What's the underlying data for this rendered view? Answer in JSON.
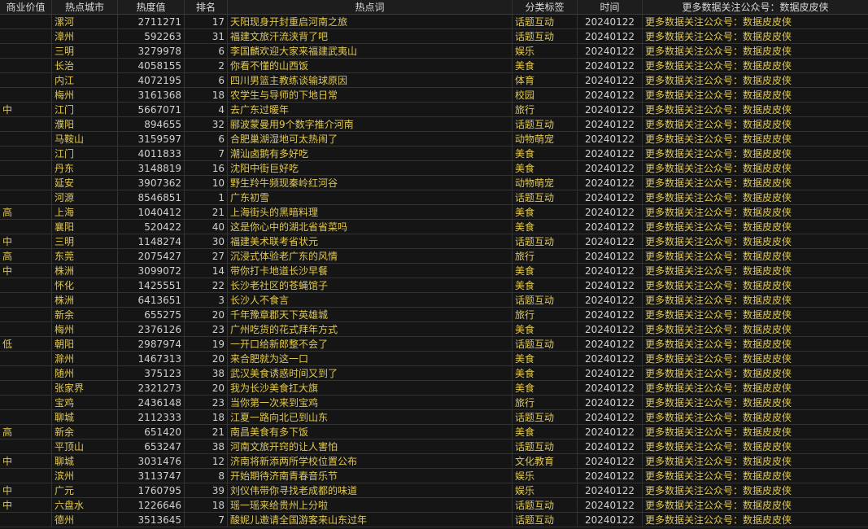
{
  "headers": [
    "商业价值",
    "热点城市",
    "热度值",
    "排名",
    "热点词",
    "分类标签",
    "时间",
    "更多数据关注公众号：数据皮皮侠"
  ],
  "rows": [
    [
      "",
      "漯河",
      "2711271",
      "17",
      "天阳现身开封重启河南之旅",
      "话题互动",
      "20240122",
      "更多数据关注公众号：数据皮皮侠"
    ],
    [
      "",
      "漳州",
      "592263",
      "31",
      "福建文旅汗流浃背了吧",
      "话题互动",
      "20240122",
      "更多数据关注公众号：数据皮皮侠"
    ],
    [
      "",
      "三明",
      "3279978",
      "6",
      "李国麟欢迎大家来福建武夷山",
      "娱乐",
      "20240122",
      "更多数据关注公众号：数据皮皮侠"
    ],
    [
      "",
      "长治",
      "4058155",
      "2",
      "你看不懂的山西饭",
      "美食",
      "20240122",
      "更多数据关注公众号：数据皮皮侠"
    ],
    [
      "",
      "内江",
      "4072195",
      "6",
      "四川男篮主教练谈输球原因",
      "体育",
      "20240122",
      "更多数据关注公众号：数据皮皮侠"
    ],
    [
      "",
      "梅州",
      "3161368",
      "18",
      "农学生与导师的下地日常",
      "校园",
      "20240122",
      "更多数据关注公众号：数据皮皮侠"
    ],
    [
      "中",
      "江门",
      "5667071",
      "4",
      "去广东过暖年",
      "旅行",
      "20240122",
      "更多数据关注公众号：数据皮皮侠"
    ],
    [
      "",
      "濮阳",
      "894655",
      "32",
      "郦波蒙曼用9个数字推介河南",
      "话题互动",
      "20240122",
      "更多数据关注公众号：数据皮皮侠"
    ],
    [
      "",
      "马鞍山",
      "3159597",
      "6",
      "合肥巢湖湿地可太热闹了",
      "动物萌宠",
      "20240122",
      "更多数据关注公众号：数据皮皮侠"
    ],
    [
      "",
      "江门",
      "4011833",
      "7",
      "潮汕卤鹅有多好吃",
      "美食",
      "20240122",
      "更多数据关注公众号：数据皮皮侠"
    ],
    [
      "",
      "丹东",
      "3148819",
      "16",
      "沈阳中街巨好吃",
      "美食",
      "20240122",
      "更多数据关注公众号：数据皮皮侠"
    ],
    [
      "",
      "延安",
      "3907362",
      "10",
      "野生羚牛频现秦岭红河谷",
      "动物萌宠",
      "20240122",
      "更多数据关注公众号：数据皮皮侠"
    ],
    [
      "",
      "河源",
      "8546851",
      "1",
      "广东初雪",
      "话题互动",
      "20240122",
      "更多数据关注公众号：数据皮皮侠"
    ],
    [
      "高",
      "上海",
      "1040412",
      "21",
      "上海街头的黑暗料理",
      "美食",
      "20240122",
      "更多数据关注公众号：数据皮皮侠"
    ],
    [
      "",
      "襄阳",
      "520422",
      "40",
      "这是你心中的湖北省省菜吗",
      "美食",
      "20240122",
      "更多数据关注公众号：数据皮皮侠"
    ],
    [
      "中",
      "三明",
      "1148274",
      "30",
      "福建美术联考省状元",
      "话题互动",
      "20240122",
      "更多数据关注公众号：数据皮皮侠"
    ],
    [
      "高",
      "东莞",
      "2075427",
      "27",
      "沉浸式体验老广东的风情",
      "旅行",
      "20240122",
      "更多数据关注公众号：数据皮皮侠"
    ],
    [
      "中",
      "株洲",
      "3099072",
      "14",
      "带你打卡地道长沙早餐",
      "美食",
      "20240122",
      "更多数据关注公众号：数据皮皮侠"
    ],
    [
      "",
      "怀化",
      "1425551",
      "22",
      "长沙老社区的苍蝇馆子",
      "美食",
      "20240122",
      "更多数据关注公众号：数据皮皮侠"
    ],
    [
      "",
      "株洲",
      "6413651",
      "3",
      "长沙人不食言",
      "话题互动",
      "20240122",
      "更多数据关注公众号：数据皮皮侠"
    ],
    [
      "",
      "新余",
      "655275",
      "20",
      "千年豫章郡天下英雄城",
      "旅行",
      "20240122",
      "更多数据关注公众号：数据皮皮侠"
    ],
    [
      "",
      "梅州",
      "2376126",
      "23",
      "广州吃货的花式拜年方式",
      "美食",
      "20240122",
      "更多数据关注公众号：数据皮皮侠"
    ],
    [
      "低",
      "朝阳",
      "2987974",
      "19",
      "一开口给新郎整不会了",
      "话题互动",
      "20240122",
      "更多数据关注公众号：数据皮皮侠"
    ],
    [
      "",
      "滁州",
      "1467313",
      "20",
      "来合肥就为这一口",
      "美食",
      "20240122",
      "更多数据关注公众号：数据皮皮侠"
    ],
    [
      "",
      "随州",
      "375123",
      "38",
      "武汉美食诱惑时间又到了",
      "美食",
      "20240122",
      "更多数据关注公众号：数据皮皮侠"
    ],
    [
      "",
      "张家界",
      "2321273",
      "20",
      "我为长沙美食扛大旗",
      "美食",
      "20240122",
      "更多数据关注公众号：数据皮皮侠"
    ],
    [
      "",
      "宝鸡",
      "2436148",
      "23",
      "当你第一次来到宝鸡",
      "旅行",
      "20240122",
      "更多数据关注公众号：数据皮皮侠"
    ],
    [
      "",
      "聊城",
      "2112333",
      "18",
      "江夏一路向北已到山东",
      "话题互动",
      "20240122",
      "更多数据关注公众号：数据皮皮侠"
    ],
    [
      "高",
      "新余",
      "651420",
      "21",
      "南昌美食有多下饭",
      "美食",
      "20240122",
      "更多数据关注公众号：数据皮皮侠"
    ],
    [
      "",
      "平顶山",
      "653247",
      "38",
      "河南文旅开窍的让人害怕",
      "话题互动",
      "20240122",
      "更多数据关注公众号：数据皮皮侠"
    ],
    [
      "中",
      "聊城",
      "3031476",
      "12",
      "济南将新添两所学校位置公布",
      "文化教育",
      "20240122",
      "更多数据关注公众号：数据皮皮侠"
    ],
    [
      "",
      "滨州",
      "3113747",
      "8",
      "开始期待济南青春音乐节",
      "娱乐",
      "20240122",
      "更多数据关注公众号：数据皮皮侠"
    ],
    [
      "中",
      "广元",
      "1760795",
      "39",
      "刘仪伟带你寻找老成都的味道",
      "娱乐",
      "20240122",
      "更多数据关注公众号：数据皮皮侠"
    ],
    [
      "中",
      "六盘水",
      "1226646",
      "18",
      "瑶一瑶来给贵州上分啦",
      "话题互动",
      "20240122",
      "更多数据关注公众号：数据皮皮侠"
    ],
    [
      "",
      "德州",
      "3513645",
      "7",
      "酸妮儿邀请全国游客来山东过年",
      "话题互动",
      "20240122",
      "更多数据关注公众号：数据皮皮侠"
    ]
  ]
}
